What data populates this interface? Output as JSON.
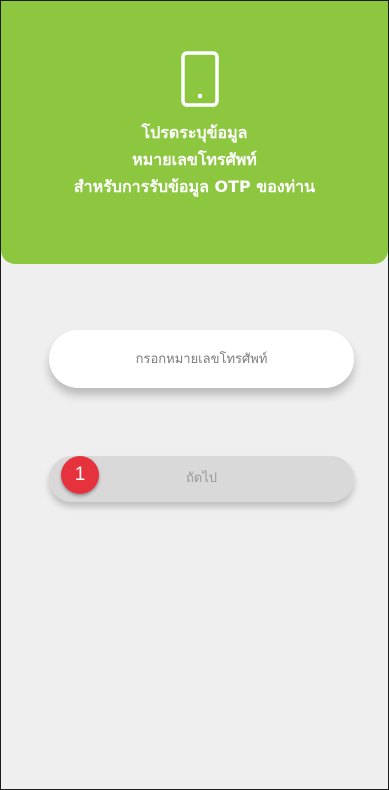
{
  "header": {
    "icon": "smartphone-icon",
    "title_lines": [
      "โปรดระบุข้อมูล",
      "หมายเลขโทรศัพท์",
      "สำหรับการรับข้อมูล OTP ของท่าน"
    ],
    "background_color": "#8cc73f"
  },
  "form": {
    "phone_placeholder": "กรอกหมายเลขโทรศัพท์",
    "phone_value": "",
    "next_label": "ถัดไป"
  },
  "step_badge": {
    "number": "1",
    "color": "#e5323d"
  }
}
